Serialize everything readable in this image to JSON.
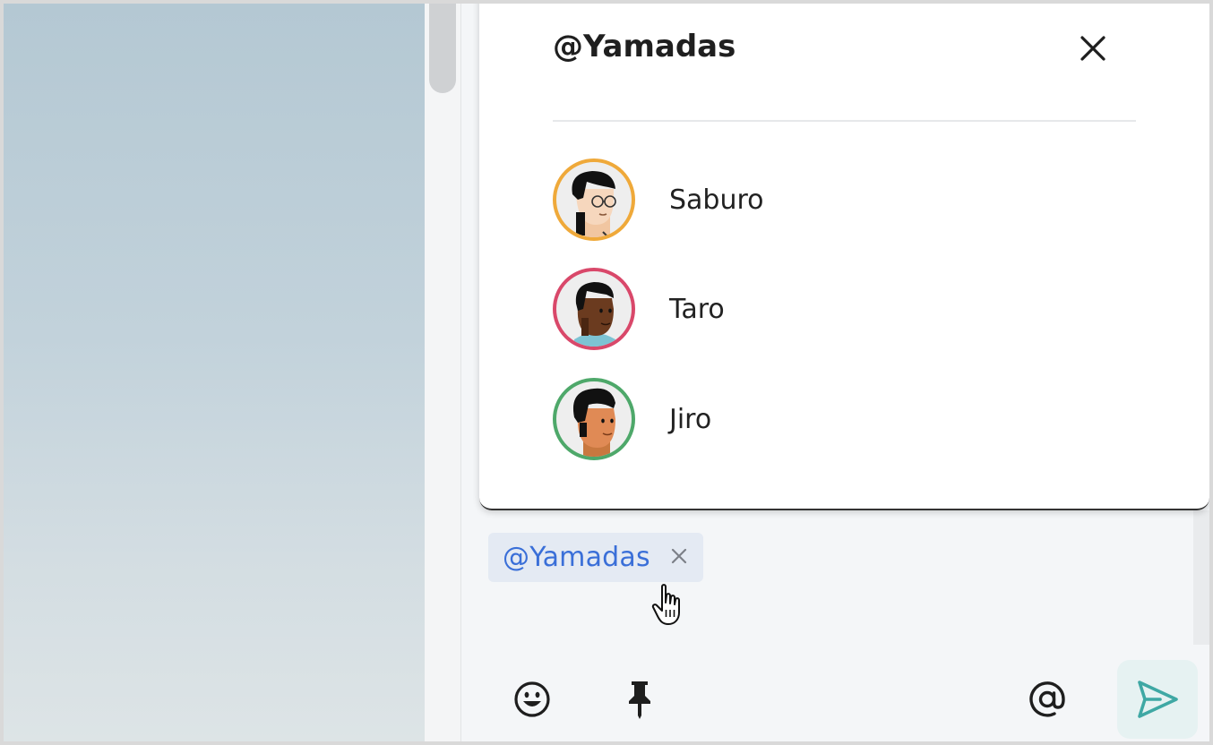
{
  "popup": {
    "title": "@Yamadas",
    "close_icon": "close-icon",
    "members": [
      {
        "name": "Saburo",
        "ring_color": "#efa93a"
      },
      {
        "name": "Taro",
        "ring_color": "#d9486a"
      },
      {
        "name": "Jiro",
        "ring_color": "#4ea86a"
      }
    ]
  },
  "composer": {
    "mention_chip": {
      "label": "@Yamadas",
      "remove_icon": "x-icon"
    },
    "toolbar": {
      "emoji_icon": "emoji-icon",
      "pin_icon": "pin-icon",
      "mention_icon": "at-icon",
      "send_icon": "send-icon"
    }
  },
  "colors": {
    "accent": "#3a6fd8",
    "send_icon": "#3fa8a4",
    "chip_bg": "#e4eaf3"
  }
}
